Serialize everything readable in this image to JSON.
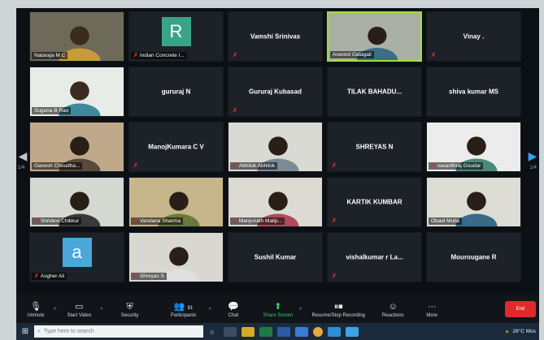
{
  "colors": {
    "accent_active_speaker": "#9be22f",
    "mic_muted": "#e02a2a",
    "share_screen": "#2fd16b",
    "end_button": "#e02a2a"
  },
  "pagination": {
    "left": "1/4",
    "right": "1/4"
  },
  "participants": [
    {
      "name": "Nataraja M C",
      "video": true,
      "muted": false
    },
    {
      "name": "Indian Concrete I...",
      "video": false,
      "avatar_letter": "R",
      "avatar_color": "#3aa38a",
      "muted": true
    },
    {
      "name": "Vamshi Srinivas",
      "video": false,
      "muted": true
    },
    {
      "name": "Aravind Galagali",
      "video": true,
      "muted": false,
      "active": true
    },
    {
      "name": "Vinay .",
      "video": false,
      "muted": true
    },
    {
      "name": "Suguna B Rao",
      "video": true,
      "muted": false
    },
    {
      "name": "gururaj N",
      "video": false,
      "muted": false
    },
    {
      "name": "Gururaj Kubasad",
      "video": false,
      "muted": true
    },
    {
      "name": "TILAK BAHADU...",
      "video": false,
      "muted": false
    },
    {
      "name": "shiva kumar MS",
      "video": false,
      "muted": false
    },
    {
      "name": "Ganesh Choudha...",
      "video": true,
      "muted": false
    },
    {
      "name": "ManojKumara C V",
      "video": false,
      "muted": true
    },
    {
      "name": "Abhilok Abhilok",
      "video": true,
      "muted": true
    },
    {
      "name": "SHREYAS N",
      "video": false,
      "muted": true
    },
    {
      "name": "vasanthraj Goudar",
      "video": true,
      "muted": true
    },
    {
      "name": "Shridevi Chikkur",
      "video": true,
      "muted": true
    },
    {
      "name": "Vandana Sharma",
      "video": true,
      "muted": true
    },
    {
      "name": "Manjunath Malip...",
      "video": true,
      "muted": true
    },
    {
      "name": "KARTIK KUMBAR",
      "video": false,
      "muted": true
    },
    {
      "name": "Obaid Mulla",
      "video": true,
      "muted": false
    },
    {
      "name": "Asgher Ali",
      "video": false,
      "avatar_letter": "a",
      "avatar_color": "#4aa7d9",
      "muted": true
    },
    {
      "name": "Shreyas S",
      "video": true,
      "muted": true
    },
    {
      "name": "Sushil Kumar",
      "video": false,
      "muted": false
    },
    {
      "name": "vishalkumar r La...",
      "video": false,
      "muted": true
    },
    {
      "name": "Mourougane R",
      "video": false,
      "muted": false
    }
  ],
  "toolbar": {
    "unmute": "Unmute",
    "start_video": "Start Video",
    "security": "Security",
    "participants": "Participants",
    "participant_count": "81",
    "chat": "Chat",
    "share_screen": "Share Screen",
    "record": "Resume/Stop Recording",
    "reactions": "Reactions",
    "more": "More",
    "end": "End"
  },
  "taskbar": {
    "search_placeholder": "Type here to search",
    "weather": "28°C Mos"
  }
}
